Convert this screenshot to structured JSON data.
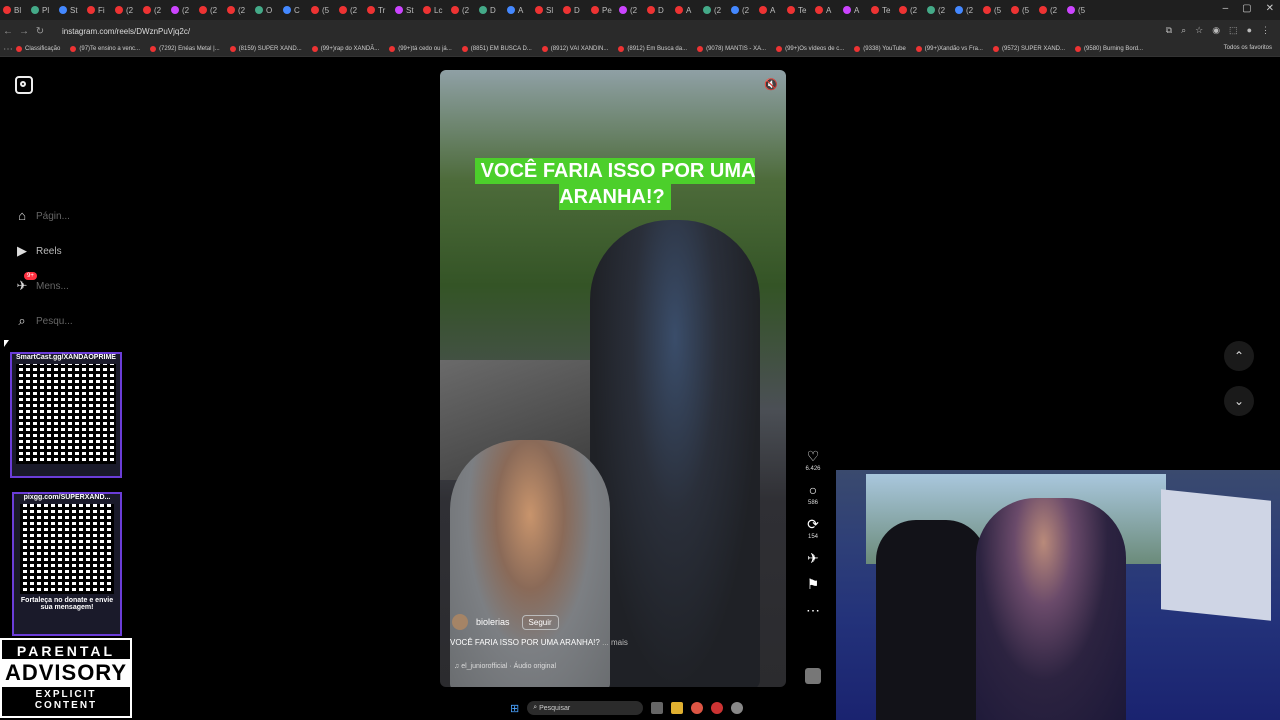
{
  "browser": {
    "tabs": [
      "Bl",
      "Pl",
      "St",
      "Fi",
      "(2",
      "(2",
      "(2",
      "(2",
      "(2",
      "O",
      "C",
      "(5",
      "(2",
      "Tr",
      "St",
      "Lc",
      "(2",
      "D",
      "A",
      "Sl",
      "D",
      "Pe",
      "(2",
      "D",
      "A",
      "(2",
      "(2",
      "A",
      "Te",
      "A",
      "A",
      "Te",
      "(2",
      "(2",
      "(2",
      "(5",
      "(5",
      "(2",
      "(5"
    ],
    "url": "instagram.com/reels/DWznPuVjq2c/",
    "bookmarks": [
      "Classificação",
      "(97)Te ensino a venc...",
      "(7292) Enéas Metal |...",
      "(8159) SUPER XAND...",
      "(99+)rap do XANDÃ...",
      "(99+)tá cedo ou já...",
      "(8851) EM BUSCA D...",
      "(8912) VAI XANDIN...",
      "(8912) Em Busca da...",
      "(9078) MANTIS - XA...",
      "(99+)Os vídeos de c...",
      "(9338) YouTube",
      "(99+)Xandão vs Fra...",
      "(9572) SUPER XAND...",
      "(9580) Burning Bord..."
    ],
    "bookmarks_right": "Todos os favoritos"
  },
  "nav": {
    "home": "Págin...",
    "reels": "Reels",
    "messages": "Mens...",
    "messages_badge": "9+",
    "search": "Pesqu..."
  },
  "overlay": {
    "qr1_caption": "SmartCast.gg/XANDAOPRIME",
    "qr2_caption": "pixgg.com/SUPERXAND...",
    "qr2_footer": "Fortaleça no donate e envie sua mensagem!",
    "advisory_top": "PARENTAL",
    "advisory_mid": "ADVISORY",
    "advisory_bottom": "EXPLICIT CONTENT"
  },
  "reel": {
    "title": "VOCÊ FARIA ISSO POR UMA ARANHA!?",
    "author": "biolerias",
    "follow": "Seguir",
    "caption": "VOCÊ FARIA ISSO POR UMA ARANHA!?",
    "caption_more": "... mais",
    "audio": "el_juniorofficial · Áudio original",
    "likes": "6.426",
    "comments": "586",
    "reposts": "154"
  },
  "taskbar": {
    "search": "Pesquisar"
  }
}
